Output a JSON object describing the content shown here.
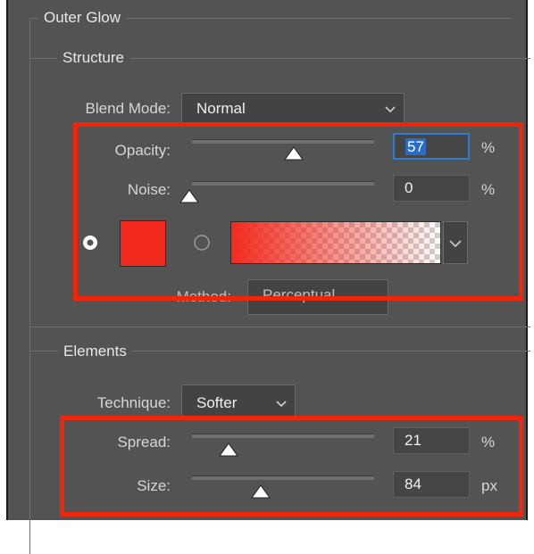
{
  "outer_glow": {
    "title": "Outer Glow"
  },
  "structure": {
    "title": "Structure",
    "blend_mode": {
      "label": "Blend Mode:",
      "value": "Normal"
    },
    "opacity": {
      "label": "Opacity:",
      "value": "57",
      "unit": "%",
      "level": 0.57
    },
    "noise": {
      "label": "Noise:",
      "value": "0",
      "unit": "%",
      "level": 0.0
    },
    "color_swatch": "#f22a1d",
    "gradient_colors": [
      "#f22a1d",
      "#ffffff"
    ],
    "method": {
      "label": "Method:",
      "value": "Perceptual"
    }
  },
  "elements": {
    "title": "Elements",
    "technique": {
      "label": "Technique:",
      "value": "Softer"
    },
    "spread": {
      "label": "Spread:",
      "value": "21",
      "unit": "%",
      "level": 0.21
    },
    "size": {
      "label": "Size:",
      "value": "84",
      "unit": "px",
      "level": 0.34
    }
  },
  "highlight_color": "#f1250b"
}
